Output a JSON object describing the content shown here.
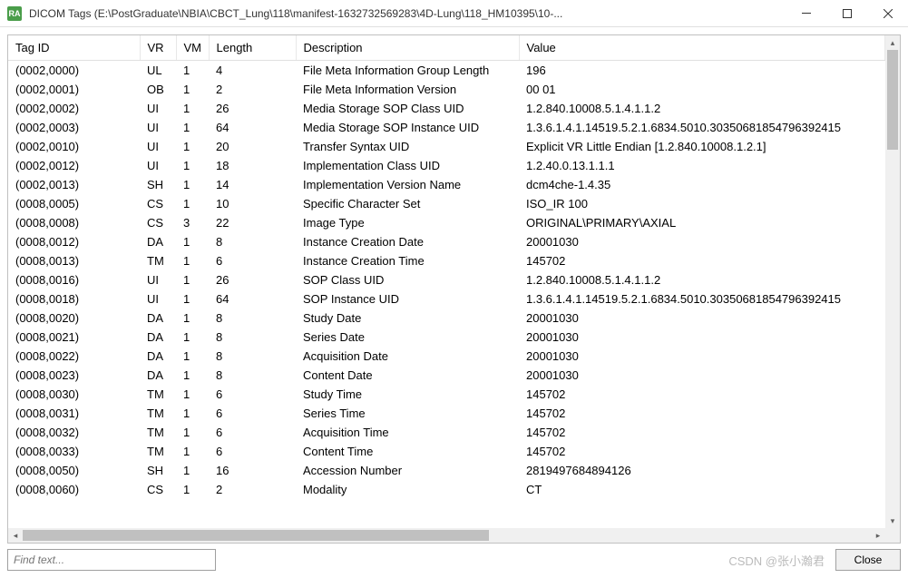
{
  "window": {
    "icon_text": "RA",
    "title": "DICOM Tags (E:\\PostGraduate\\NBIA\\CBCT_Lung\\118\\manifest-1632732569283\\4D-Lung\\118_HM10395\\10-..."
  },
  "columns": {
    "tagid": "Tag ID",
    "vr": "VR",
    "vm": "VM",
    "length": "Length",
    "description": "Description",
    "value": "Value"
  },
  "rows": [
    {
      "tagid": "(0002,0000)",
      "vr": "UL",
      "vm": "1",
      "length": "4",
      "description": "File Meta Information Group Length",
      "value": "196"
    },
    {
      "tagid": "(0002,0001)",
      "vr": "OB",
      "vm": "1",
      "length": "2",
      "description": "File Meta Information Version",
      "value": "00 01"
    },
    {
      "tagid": "(0002,0002)",
      "vr": "UI",
      "vm": "1",
      "length": "26",
      "description": "Media Storage SOP Class UID",
      "value": "1.2.840.10008.5.1.4.1.1.2"
    },
    {
      "tagid": "(0002,0003)",
      "vr": "UI",
      "vm": "1",
      "length": "64",
      "description": "Media Storage SOP Instance UID",
      "value": "1.3.6.1.4.1.14519.5.2.1.6834.5010.30350681854796392415"
    },
    {
      "tagid": "(0002,0010)",
      "vr": "UI",
      "vm": "1",
      "length": "20",
      "description": "Transfer Syntax UID",
      "value": "Explicit VR Little Endian [1.2.840.10008.1.2.1]"
    },
    {
      "tagid": "(0002,0012)",
      "vr": "UI",
      "vm": "1",
      "length": "18",
      "description": "Implementation Class UID",
      "value": "1.2.40.0.13.1.1.1"
    },
    {
      "tagid": "(0002,0013)",
      "vr": "SH",
      "vm": "1",
      "length": "14",
      "description": "Implementation Version Name",
      "value": "dcm4che-1.4.35"
    },
    {
      "tagid": "(0008,0005)",
      "vr": "CS",
      "vm": "1",
      "length": "10",
      "description": "Specific Character Set",
      "value": "ISO_IR 100"
    },
    {
      "tagid": "(0008,0008)",
      "vr": "CS",
      "vm": "3",
      "length": "22",
      "description": "Image Type",
      "value": "ORIGINAL\\PRIMARY\\AXIAL"
    },
    {
      "tagid": "(0008,0012)",
      "vr": "DA",
      "vm": "1",
      "length": "8",
      "description": "Instance Creation Date",
      "value": "20001030"
    },
    {
      "tagid": "(0008,0013)",
      "vr": "TM",
      "vm": "1",
      "length": "6",
      "description": "Instance Creation Time",
      "value": "145702"
    },
    {
      "tagid": "(0008,0016)",
      "vr": "UI",
      "vm": "1",
      "length": "26",
      "description": "SOP Class UID",
      "value": "1.2.840.10008.5.1.4.1.1.2"
    },
    {
      "tagid": "(0008,0018)",
      "vr": "UI",
      "vm": "1",
      "length": "64",
      "description": "SOP Instance UID",
      "value": "1.3.6.1.4.1.14519.5.2.1.6834.5010.30350681854796392415"
    },
    {
      "tagid": "(0008,0020)",
      "vr": "DA",
      "vm": "1",
      "length": "8",
      "description": "Study Date",
      "value": "20001030"
    },
    {
      "tagid": "(0008,0021)",
      "vr": "DA",
      "vm": "1",
      "length": "8",
      "description": "Series Date",
      "value": "20001030"
    },
    {
      "tagid": "(0008,0022)",
      "vr": "DA",
      "vm": "1",
      "length": "8",
      "description": "Acquisition Date",
      "value": "20001030"
    },
    {
      "tagid": "(0008,0023)",
      "vr": "DA",
      "vm": "1",
      "length": "8",
      "description": "Content Date",
      "value": "20001030"
    },
    {
      "tagid": "(0008,0030)",
      "vr": "TM",
      "vm": "1",
      "length": "6",
      "description": "Study Time",
      "value": "145702"
    },
    {
      "tagid": "(0008,0031)",
      "vr": "TM",
      "vm": "1",
      "length": "6",
      "description": "Series Time",
      "value": "145702"
    },
    {
      "tagid": "(0008,0032)",
      "vr": "TM",
      "vm": "1",
      "length": "6",
      "description": "Acquisition Time",
      "value": "145702"
    },
    {
      "tagid": "(0008,0033)",
      "vr": "TM",
      "vm": "1",
      "length": "6",
      "description": "Content Time",
      "value": "145702"
    },
    {
      "tagid": "(0008,0050)",
      "vr": "SH",
      "vm": "1",
      "length": "16",
      "description": "Accession Number",
      "value": "2819497684894126"
    },
    {
      "tagid": "(0008,0060)",
      "vr": "CS",
      "vm": "1",
      "length": "2",
      "description": "Modality",
      "value": "CT"
    }
  ],
  "find": {
    "placeholder": "Find text..."
  },
  "watermark": "CSDN @张小瀚君",
  "close_label": "Close"
}
